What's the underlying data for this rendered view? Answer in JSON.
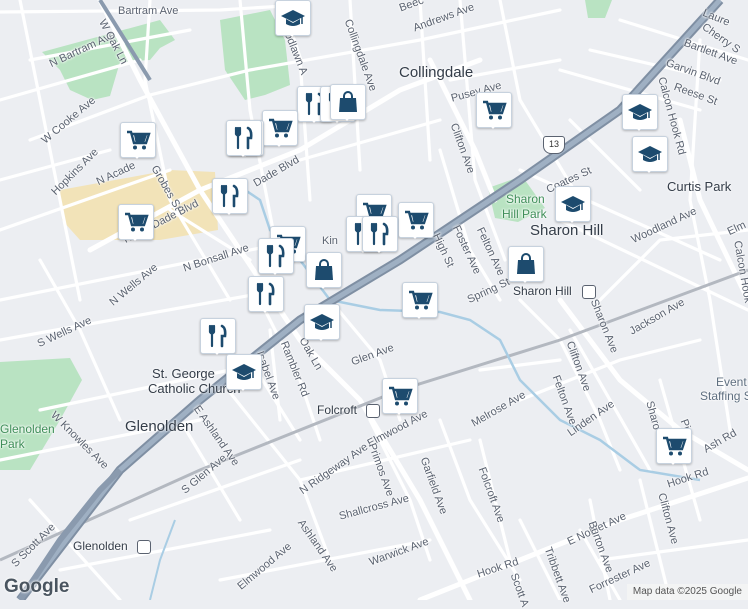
{
  "places": {
    "collingdale": "Collingdale",
    "sharon_hill": "Sharon Hill",
    "glenolden": "Glenolden",
    "curtis_park": "Curtis Park",
    "st_george": "St. George",
    "st_george_2": "Catholic Church",
    "sharon_hill_park_1": "Sharon",
    "sharon_hill_park_2": "Hill Park",
    "glenolden_park_1": "Glenolden",
    "glenolden_park_2": "Park",
    "eventus_1": "Event",
    "eventus_2": "Staffing S"
  },
  "stations": {
    "sharon_hill": "Sharon Hill",
    "folcroft": "Folcroft",
    "glenolden": "Glenolden"
  },
  "route_shield": "13",
  "streets": {
    "bartram_ave": "Bartram Ave",
    "n_bartram_ave": "N Bartram Ave",
    "w_oak_ln": "W Oak Ln",
    "woodlawn": "Woodlawn A",
    "collingdale_ave": "Collingdale Ave",
    "andrews_ave": "Andrews Ave",
    "beech": "Beec",
    "pusey_ave": "Pusey Ave",
    "laurel": "Laure",
    "cherry": "Cherry S",
    "bartlett": "Bartlett Ave",
    "garvin": "Garvin Blvd",
    "reese": "Reese St",
    "calcon_hook_rd": "Calcon Hook Rd",
    "calcon_hook_rd_2": "Calcon Hook",
    "w_cooke": "W Cooke Ave",
    "hopkins": "Hopkins Ave",
    "n_academy": "N Acade",
    "grobes": "Grobes St",
    "dade": "Dade Blvd",
    "n_macdade": "N MacDade Blvd",
    "clifton_ave": "Clifton Ave",
    "coates": "Coates St",
    "woodland": "Woodland Ave",
    "elm": "Elm",
    "n_wells": "N Wells Ave",
    "n_bonsall": "N Bonsall Ave",
    "high": "High St",
    "foster": "Foster Ave",
    "felton": "Felton Ave",
    "spring": "Spring St",
    "kin": "Kin",
    "s_wells": "S Wells Ave",
    "jackson": "Jackson Ave",
    "sharon_ave": "Sharon Ave",
    "oak_ln": "Oak Ln",
    "rambler": "Rambler Rd",
    "isabel": "Isabel Ave",
    "glen": "Glen Ave",
    "clifton_ave_s": "Clifton Ave",
    "felton_s": "Felton Ave",
    "linden": "Linden Ave",
    "melrose": "Melrose Ave",
    "elmwood": "Elmwood Ave",
    "w_knowles": "W Knowles Ave",
    "e_ashland": "E Ashland Ave",
    "s_glen": "S Glen Ave",
    "n_ridgeway": "N Ridgeway Ave",
    "primos": "Primos Ave",
    "garfield": "Garfield Ave",
    "folcroft_ave": "Folcroft Ave",
    "ash": "Ash Rd",
    "hook_rd": "Hook Rd",
    "hook_rd_2": "Hook Rd",
    "clifton_ave_se": "Clifton Ave",
    "sharo": "Sharo",
    "pine": "Pin",
    "shallcross": "Shallcross Ave",
    "ashland": "Ashland Ave",
    "elmwood_sw": "Elmwood Ave",
    "warwick": "Warwick Ave",
    "s_scott": "S Scott Ave",
    "e_noblet": "E Noblet Ave",
    "burton": "Burton Ave",
    "tribbett": "Tribbett Ave",
    "scott": "Scott A",
    "forrester": "Forrester Ave"
  },
  "footer": {
    "logo": "Google",
    "attribution": "Map data ©2025 Google"
  },
  "colors": {
    "background": "#eceef2",
    "road": "#ffffff",
    "highway": "#8a9aae",
    "park": "#b9e3c2",
    "school_area": "#f2e3b8",
    "water": "#a9cde4",
    "poi_icon": "#1d4b6e",
    "rail": "#b3b8c0"
  },
  "pois": [
    {
      "type": "school",
      "icon": "graduation-cap-icon"
    },
    {
      "type": "grocery",
      "icon": "shopping-cart-icon"
    },
    {
      "type": "restaurant",
      "icon": "fork-knife-icon"
    },
    {
      "type": "restaurant",
      "icon": "fork-knife-icon"
    },
    {
      "type": "shopping",
      "icon": "shopping-bag-icon"
    },
    {
      "type": "grocery",
      "icon": "shopping-cart-icon"
    },
    {
      "type": "school",
      "icon": "graduation-cap-icon"
    },
    {
      "type": "grocery",
      "icon": "shopping-cart-icon"
    },
    {
      "type": "restaurant",
      "icon": "fork-knife-icon"
    },
    {
      "type": "grocery",
      "icon": "shopping-cart-icon"
    },
    {
      "type": "school",
      "icon": "graduation-cap-icon"
    },
    {
      "type": "school",
      "icon": "graduation-cap-icon"
    },
    {
      "type": "restaurant",
      "icon": "fork-knife-icon"
    },
    {
      "type": "grocery",
      "icon": "shopping-cart-icon"
    },
    {
      "type": "grocery",
      "icon": "shopping-cart-icon"
    },
    {
      "type": "grocery",
      "icon": "shopping-cart-icon"
    },
    {
      "type": "restaurant",
      "icon": "fork-knife-icon"
    },
    {
      "type": "restaurant",
      "icon": "fork-knife-icon"
    },
    {
      "type": "grocery",
      "icon": "shopping-cart-icon"
    },
    {
      "type": "restaurant",
      "icon": "fork-knife-icon"
    },
    {
      "type": "shopping",
      "icon": "shopping-bag-icon"
    },
    {
      "type": "restaurant",
      "icon": "fork-knife-icon"
    },
    {
      "type": "school",
      "icon": "graduation-cap-icon"
    },
    {
      "type": "grocery",
      "icon": "shopping-cart-icon"
    },
    {
      "type": "shopping",
      "icon": "shopping-bag-icon"
    },
    {
      "type": "restaurant",
      "icon": "fork-knife-icon"
    },
    {
      "type": "school",
      "icon": "graduation-cap-icon"
    },
    {
      "type": "grocery",
      "icon": "shopping-cart-icon"
    },
    {
      "type": "grocery",
      "icon": "shopping-cart-icon"
    }
  ]
}
